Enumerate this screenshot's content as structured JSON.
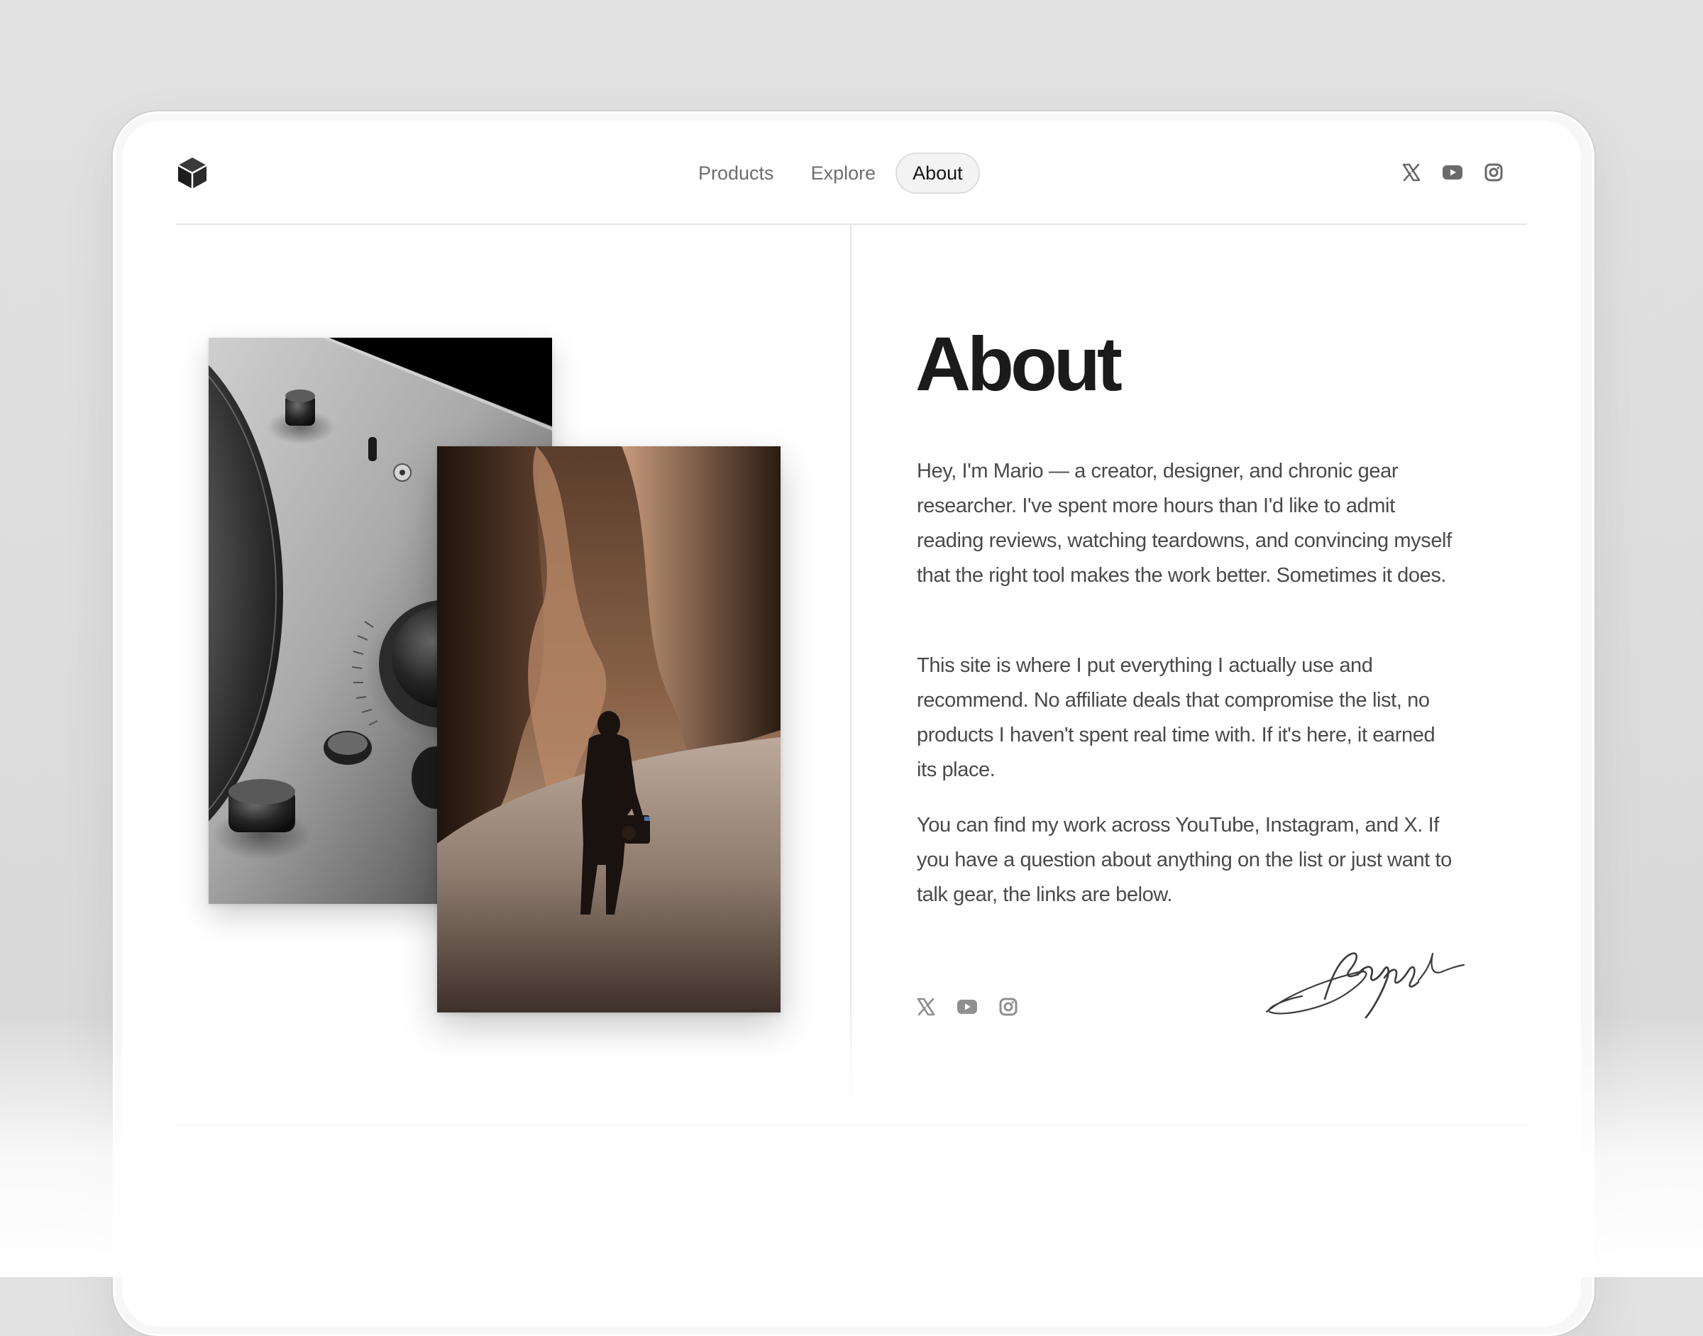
{
  "brand": {
    "logo_icon": "cube-icon"
  },
  "nav": {
    "items": [
      {
        "label": "Products",
        "active": false
      },
      {
        "label": "Explore",
        "active": false
      },
      {
        "label": "About",
        "active": true
      }
    ]
  },
  "social": {
    "header": [
      {
        "icon": "x-icon"
      },
      {
        "icon": "youtube-icon"
      },
      {
        "icon": "instagram-icon"
      }
    ],
    "footer": [
      {
        "icon": "x-icon"
      },
      {
        "icon": "youtube-icon"
      },
      {
        "icon": "instagram-icon"
      }
    ]
  },
  "about": {
    "title": "About",
    "paragraphs": [
      "Hey, I'm Mario — a creator, designer, and chronic gear researcher. I've spent more hours than I'd like to admit reading reviews, watching teardowns, and convincing myself that the right tool makes the work better. Sometimes it does.",
      "This site is where I put everything I actually use and recommend. No affiliate deals that compromise the list, no products I haven't spent real time with. If it's here, it earned its place.",
      "You can find my work across YouTube, Instagram, and X. If you have a question about anything on the list or just want to talk gear, the links are below."
    ]
  },
  "images": {
    "amp": "amplifier-photo",
    "canyon": "canyon-photo",
    "signature": "signature-image"
  },
  "colors": {
    "background": "#dedede",
    "surface": "#ffffff",
    "text": "#1b1b1b",
    "body_text": "#4a4a4a",
    "nav_text": "#6e6e6e",
    "divider": "#e6e6e6"
  }
}
